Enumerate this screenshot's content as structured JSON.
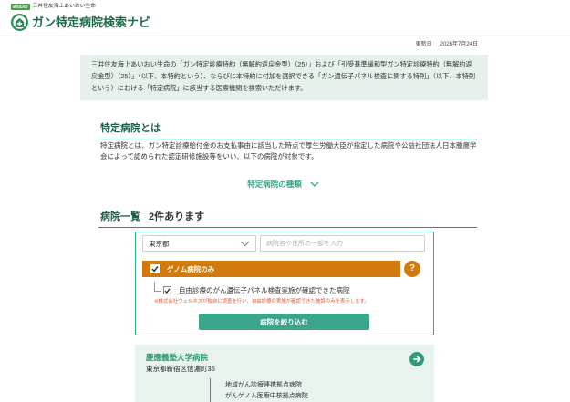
{
  "header": {
    "brand_badge": "MS&AD",
    "company_name": "三井住友海上あいおい生命",
    "logo_icon": "hospital-cross-icon",
    "site_title": "ガン特定病院検索ナビ"
  },
  "updated": {
    "label": "更新日",
    "date": "2026年7月24日"
  },
  "intro": {
    "text": "三井住友海上あいおい生命の「ガン特定診療特約（無解約返戻金型）（25）」および「引受基準緩和型ガン特定診療特約（無解約返戻金型）（25）」（以下、本特約という）、ならびに本特約に付加を選択できる「ガン遺伝子パネル検査に関する特則」（以下、本特則という）における「特定病院」に該当する医療機関を検索いただけます。"
  },
  "about": {
    "heading": "特定病院とは",
    "text": "特定病院とは、ガン特定診療給付金のお支払事由に該当した時点で厚生労働大臣が指定した病院や公益社団法人日本腫瘍学会によって認められた認定研修施設等をいい、以下の病院が対象です。",
    "types_link": "特定病院の種類",
    "types_icon": "chevron-down-icon"
  },
  "list": {
    "heading": "病院一覧",
    "count_text": "2件あります"
  },
  "search": {
    "prefecture": "東京都",
    "prefecture_icon": "chevron-down-icon",
    "keyword_value": "",
    "keyword_placeholder": "病院名や住所の一部を入力",
    "genome_only_label": "ゲノム病院のみ",
    "genome_only_checked": true,
    "help_label": "?",
    "self_pay_label": "自由診療のがん遺伝子パネル検査実施が確認できた病院",
    "self_pay_checked": true,
    "note": "※株式会社ウェルネスが独自に調査を行い、自由診療の実施が確認できた施設のみを表示します。",
    "submit_label": "病院を絞り込む"
  },
  "results": [
    {
      "name": "慶應義塾大学病院",
      "address": "東京都新宿区信濃町35",
      "detail_icon": "arrow-right-icon",
      "designations": [
        "地域がん診療連携拠点病院",
        "がんゲノム医療中核拠点病院"
      ]
    }
  ],
  "colors": {
    "brand_green": "#1f6a4b",
    "heading_green": "#215e4a",
    "accent_teal": "#3aa58b",
    "rule_green": "#2e8c70",
    "intro_bg": "#e5f1ea",
    "genome_orange": "#d2790c",
    "note_red": "#e4572e",
    "card_bg": "#e8f3ee",
    "link_green": "#2f9a73",
    "badge_green": "#4f9a4c"
  }
}
